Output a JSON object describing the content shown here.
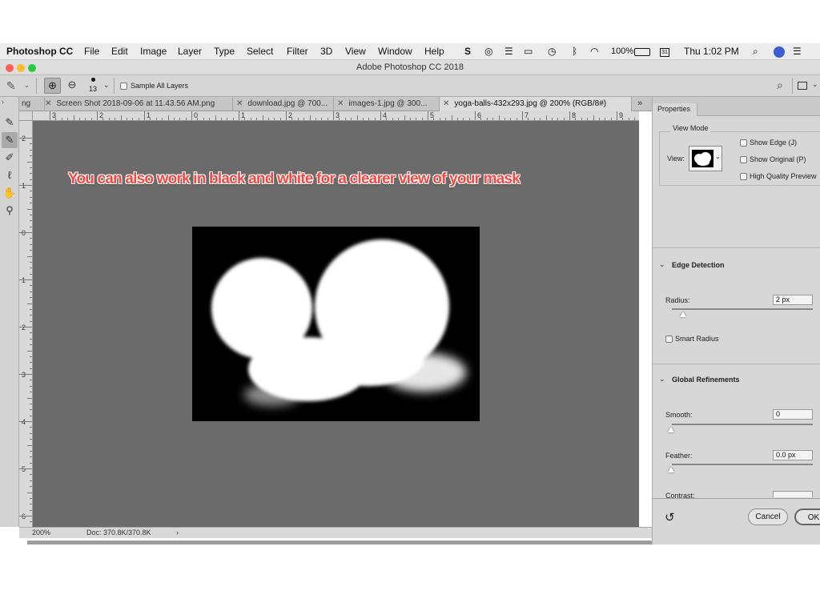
{
  "menubar": {
    "app_name": "Photoshop CC",
    "items": [
      "File",
      "Edit",
      "Image",
      "Layer",
      "Type",
      "Select",
      "Filter",
      "3D",
      "View",
      "Window",
      "Help"
    ],
    "battery": "100%",
    "clock": "Thu 1:02 PM"
  },
  "window": {
    "title": "Adobe Photoshop CC 2018"
  },
  "options_bar": {
    "brush_size": "13",
    "sample_all_layers": "Sample All Layers"
  },
  "tabs": [
    {
      "label": "ng"
    },
    {
      "label": "Screen Shot 2018-09-06 at 11.43.56 AM.png"
    },
    {
      "label": "download.jpg @ 700..."
    },
    {
      "label": "images-1.jpg @ 300..."
    },
    {
      "label": "yoga-balls-432x293.jpg @ 200% (RGB/8#)"
    }
  ],
  "tab_overflow": "»",
  "ruler": {
    "h_labels": [
      "3",
      "2",
      "1",
      "0",
      "1",
      "2",
      "3",
      "4",
      "5",
      "6",
      "7",
      "8",
      "9"
    ],
    "v_labels": [
      "2",
      "1",
      "0",
      "1",
      "2",
      "3",
      "4",
      "5",
      "6"
    ]
  },
  "canvas": {
    "caption": "You can also work in black and white for a clearer view of your mask"
  },
  "status": {
    "zoom": "200%",
    "doc": "Doc: 370.8K/370.8K",
    "arrow": "›"
  },
  "properties": {
    "panel_title": "Properties",
    "view_mode": {
      "heading": "View Mode",
      "view_label": "View:",
      "show_edge": "Show Edge (J)",
      "show_original": "Show Original (P)",
      "high_quality": "High Quality Preview"
    },
    "edge_detection": {
      "heading": "Edge Detection",
      "radius_label": "Radius:",
      "radius_value": "2 px",
      "radius_slider": 0.08,
      "smart_radius": "Smart Radius"
    },
    "global_refinements": {
      "heading": "Global Refinements",
      "smooth_label": "Smooth:",
      "smooth_value": "0",
      "feather_label": "Feather:",
      "feather_value": "0.0 px",
      "contrast_label": "Contrast:"
    },
    "buttons": {
      "cancel": "Cancel",
      "ok": "OK"
    }
  },
  "colors": {
    "caption_red": "#f04a44",
    "canvas_gray": "#6b6b6b",
    "panel_gray": "#d7d7d7"
  }
}
